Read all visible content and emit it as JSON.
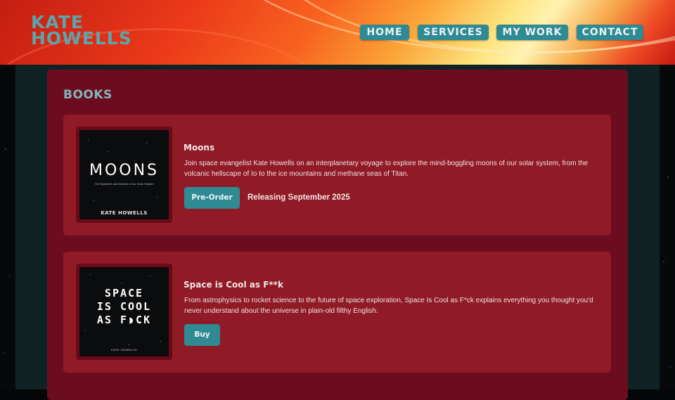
{
  "header": {
    "logo_line1": "KATE",
    "logo_line2": "HOWELLS",
    "nav": [
      {
        "label": "HOME"
      },
      {
        "label": "SERVICES"
      },
      {
        "label": "MY WORK"
      },
      {
        "label": "CONTACT"
      }
    ]
  },
  "section": {
    "title": "BOOKS"
  },
  "books": [
    {
      "title": "Moons",
      "description": "Join space evangelist Kate Howells on an interplanetary voyage to explore the mind-boggling moons of our solar system, from the volcanic hellscape of Io to the ice mountains and methane seas of Titan.",
      "button_label": "Pre-Order",
      "release_text": "Releasing September 2025",
      "cover": {
        "title": "MOONS",
        "subtitle": "The Mysteries and Marvels of our Solar System",
        "author": "KATE HOWELLS"
      }
    },
    {
      "title": "Space is Cool as F**k",
      "description": "From astrophysics to rocket science to the future of space exploration, Space Is Cool as F*ck explains everything you thought you'd never understand about the universe in plain-old filthy English.",
      "button_label": "Buy",
      "cover": {
        "line1": "SPACE",
        "line2": "IS COOL",
        "line3": "AS F◗CK",
        "author": "KATE HOWELLS"
      }
    }
  ],
  "colors": {
    "accent": "#2f8a93",
    "panel": "#6c0d1f",
    "card": "#901a25",
    "column": "#0f2325"
  }
}
